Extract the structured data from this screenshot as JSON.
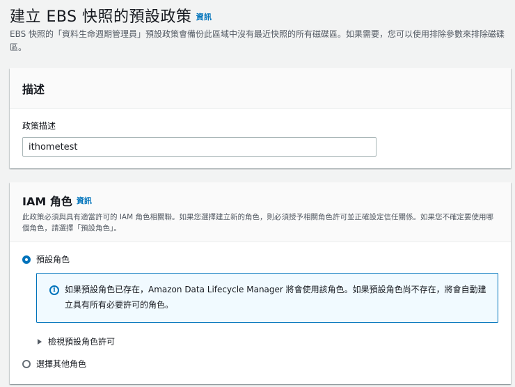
{
  "page": {
    "title": "建立 EBS 快照的預設政策",
    "info": "資訊",
    "description": "EBS 快照的「資料生命週期管理員」預設政策會備份此區域中沒有最近快照的所有磁碟區。如果需要，您可以使用排除參數來排除磁碟區。"
  },
  "description_card": {
    "title": "描述",
    "field_label": "政策描述",
    "field_value": "ithometest"
  },
  "iam_card": {
    "title": "IAM 角色",
    "info": "資訊",
    "subtitle": "此政策必須與具有適當許可的 IAM 角色相關聯。如果您選擇建立新的角色，則必須授予相關角色許可並正確設定信任關係。如果您不確定要使用哪個角色，請選擇「預設角色」。",
    "option_default": "預設角色",
    "alert_text": "如果預設角色已存在，Amazon Data Lifecycle Manager 將會使用該角色。如果預設角色尚不存在，將會自動建立具有所有必要許可的角色。",
    "alert_icon": "info-icon",
    "expander_label": "檢視預設角色許可",
    "option_other": "選擇其他角色"
  },
  "colors": {
    "accent": "#0073bb",
    "alert_bg": "#f1faff"
  }
}
